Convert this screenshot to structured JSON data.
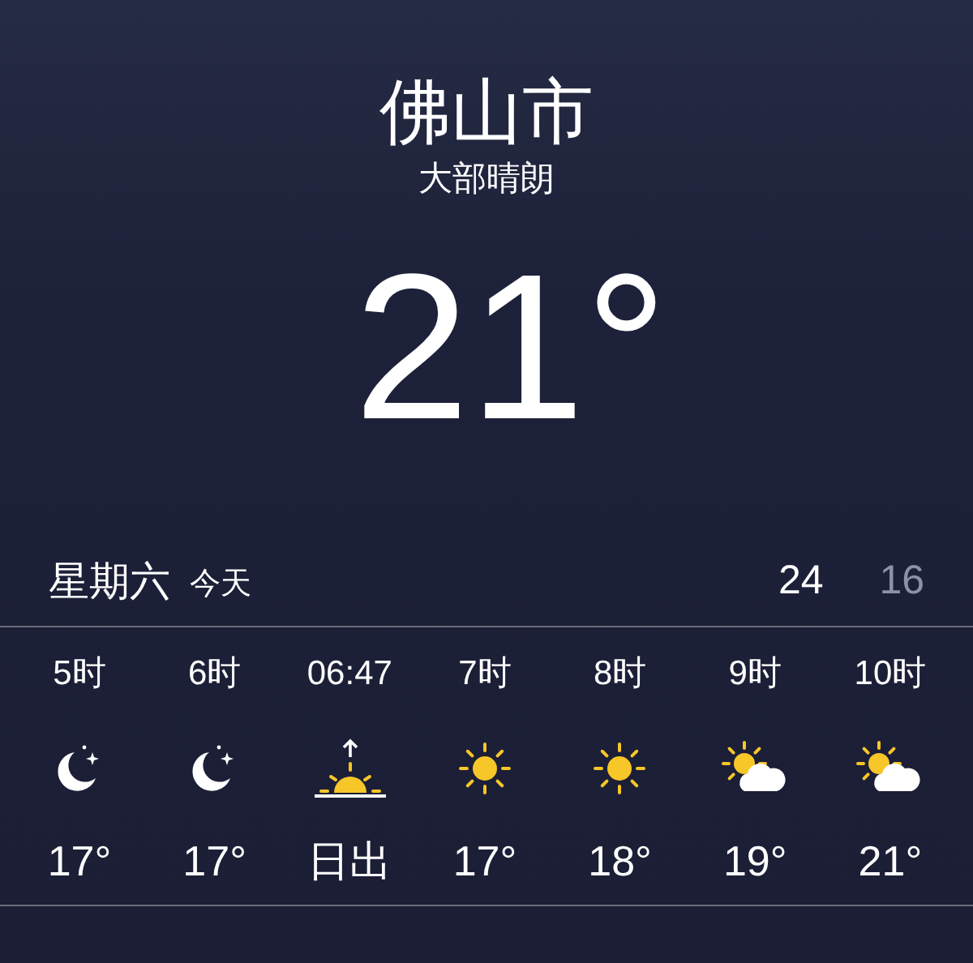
{
  "location": {
    "city": "佛山市",
    "condition": "大部晴朗",
    "temperature": "21°"
  },
  "today": {
    "day": "星期六",
    "label": "今天",
    "high": "24",
    "low": "16"
  },
  "hourly": [
    {
      "time": "5时",
      "kind": "moon",
      "temp": "17°"
    },
    {
      "time": "6时",
      "kind": "moon",
      "temp": "17°"
    },
    {
      "time": "06:47",
      "kind": "sunrise",
      "temp": "日出"
    },
    {
      "time": "7时",
      "kind": "sun",
      "temp": "17°"
    },
    {
      "time": "8时",
      "kind": "sun",
      "temp": "18°"
    },
    {
      "time": "9时",
      "kind": "partly-cloudy",
      "temp": "19°"
    },
    {
      "time": "10时",
      "kind": "partly-cloudy",
      "temp": "21°"
    }
  ]
}
